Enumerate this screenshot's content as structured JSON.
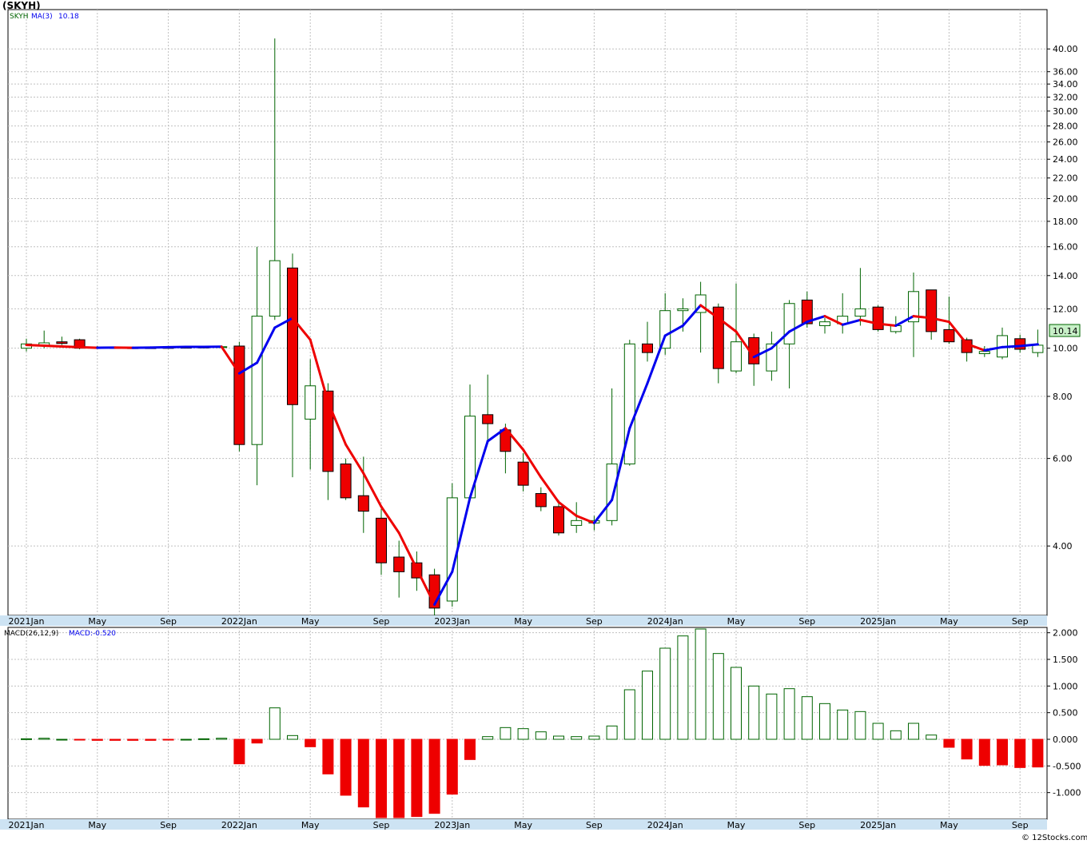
{
  "header": {
    "title": "(SKYH)",
    "legend_symbol": "SKYH",
    "legend_ma": "MA(3)",
    "legend_ma_value": "10.18",
    "last_price": "10.14"
  },
  "macd_header": {
    "label": "MACD(26,12,9)",
    "value_label": "MACD:-0.520"
  },
  "credit": "© 12Stocks.com",
  "colors": {
    "up": "#006400",
    "down": "#ee0000",
    "ma_rising": "#0000ee",
    "ma_falling": "#ee0000",
    "grid": "#c0c0c0",
    "axis_band": "#cde3f3",
    "last_price_bg": "#c8f0c8"
  },
  "chart_data": [
    {
      "type": "candlestick",
      "title": "(SKYH)",
      "scale": "log",
      "ylim": [
        2.9,
        48
      ],
      "grid": true,
      "x_tick_labels": [
        "2021Jan",
        "May",
        "Sep",
        "2022Jan",
        "May",
        "Sep",
        "2023Jan",
        "May",
        "Sep",
        "2024Jan",
        "May",
        "Sep",
        "2025Jan",
        "May",
        "Sep"
      ],
      "y_tick_labels": [
        "4.00",
        "6.00",
        "8.00",
        "10.00",
        "12.00",
        "14.00",
        "16.00",
        "18.00",
        "20.00",
        "22.00",
        "24.00",
        "26.00",
        "28.00",
        "30.00",
        "32.00",
        "34.00",
        "36.00",
        "40.00"
      ],
      "candles": [
        {
          "m": "2021-01",
          "o": 10.0,
          "h": 10.45,
          "l": 9.85,
          "c": 10.2
        },
        {
          "m": "2021-02",
          "o": 10.1,
          "h": 10.85,
          "l": 10.0,
          "c": 10.25
        },
        {
          "m": "2021-03",
          "o": 10.3,
          "h": 10.55,
          "l": 10.15,
          "c": 10.22
        },
        {
          "m": "2021-04",
          "o": 10.4,
          "h": 10.45,
          "l": 9.95,
          "c": 10.0
        },
        {
          "m": "2021-05",
          "o": 10.05,
          "h": 10.1,
          "l": 9.97,
          "c": 10.02
        },
        {
          "m": "2021-06",
          "o": 10.03,
          "h": 10.06,
          "l": 9.98,
          "c": 10.01
        },
        {
          "m": "2021-07",
          "o": 10.02,
          "h": 10.05,
          "l": 9.98,
          "c": 10.0
        },
        {
          "m": "2021-08",
          "o": 10.02,
          "h": 10.06,
          "l": 9.98,
          "c": 10.01
        },
        {
          "m": "2021-09",
          "o": 10.03,
          "h": 10.08,
          "l": 9.99,
          "c": 10.02
        },
        {
          "m": "2021-10",
          "o": 10.04,
          "h": 10.09,
          "l": 10.0,
          "c": 10.03
        },
        {
          "m": "2021-11",
          "o": 10.05,
          "h": 10.1,
          "l": 10.0,
          "c": 10.04
        },
        {
          "m": "2021-12",
          "o": 10.06,
          "h": 10.12,
          "l": 10.01,
          "c": 10.07
        },
        {
          "m": "2022-01",
          "o": 10.1,
          "h": 10.3,
          "l": 6.2,
          "c": 6.4
        },
        {
          "m": "2022-02",
          "o": 6.4,
          "h": 16.0,
          "l": 5.3,
          "c": 11.6
        },
        {
          "m": "2022-03",
          "o": 11.6,
          "h": 42.0,
          "l": 11.4,
          "c": 15.0
        },
        {
          "m": "2022-04",
          "o": 14.5,
          "h": 15.5,
          "l": 5.5,
          "c": 7.7
        },
        {
          "m": "2022-05",
          "o": 7.2,
          "h": 9.5,
          "l": 5.7,
          "c": 8.4
        },
        {
          "m": "2022-06",
          "o": 8.2,
          "h": 8.5,
          "l": 4.95,
          "c": 5.65
        },
        {
          "m": "2022-07",
          "o": 5.85,
          "h": 6.0,
          "l": 4.95,
          "c": 5.0
        },
        {
          "m": "2022-08",
          "o": 5.05,
          "h": 6.05,
          "l": 4.25,
          "c": 4.7
        },
        {
          "m": "2022-09",
          "o": 4.55,
          "h": 4.75,
          "l": 3.5,
          "c": 3.7
        },
        {
          "m": "2022-10",
          "o": 3.8,
          "h": 4.1,
          "l": 3.15,
          "c": 3.55
        },
        {
          "m": "2022-11",
          "o": 3.7,
          "h": 3.9,
          "l": 3.25,
          "c": 3.45
        },
        {
          "m": "2022-12",
          "o": 3.5,
          "h": 3.6,
          "l": 2.85,
          "c": 3.0
        },
        {
          "m": "2023-01",
          "o": 3.1,
          "h": 5.35,
          "l": 3.02,
          "c": 5.0
        },
        {
          "m": "2023-02",
          "o": 5.0,
          "h": 8.45,
          "l": 5.0,
          "c": 7.3
        },
        {
          "m": "2023-03",
          "o": 7.35,
          "h": 8.85,
          "l": 6.5,
          "c": 7.05
        },
        {
          "m": "2023-04",
          "o": 6.85,
          "h": 7.05,
          "l": 5.6,
          "c": 6.2
        },
        {
          "m": "2023-05",
          "o": 5.9,
          "h": 6.15,
          "l": 5.15,
          "c": 5.3
        },
        {
          "m": "2023-06",
          "o": 5.1,
          "h": 5.25,
          "l": 4.7,
          "c": 4.8
        },
        {
          "m": "2023-07",
          "o": 4.8,
          "h": 4.95,
          "l": 4.2,
          "c": 4.25
        },
        {
          "m": "2023-08",
          "o": 4.4,
          "h": 4.9,
          "l": 4.25,
          "c": 4.5
        },
        {
          "m": "2023-09",
          "o": 4.45,
          "h": 4.6,
          "l": 4.3,
          "c": 4.5
        },
        {
          "m": "2023-10",
          "o": 4.5,
          "h": 8.3,
          "l": 4.4,
          "c": 5.85
        },
        {
          "m": "2023-11",
          "o": 5.85,
          "h": 10.4,
          "l": 5.8,
          "c": 10.2
        },
        {
          "m": "2023-12",
          "o": 10.2,
          "h": 11.3,
          "l": 9.4,
          "c": 9.8
        },
        {
          "m": "2024-01",
          "o": 10.0,
          "h": 12.9,
          "l": 9.7,
          "c": 11.9
        },
        {
          "m": "2024-02",
          "o": 11.9,
          "h": 12.6,
          "l": 10.8,
          "c": 12.0
        },
        {
          "m": "2024-03",
          "o": 11.8,
          "h": 13.6,
          "l": 9.8,
          "c": 12.8
        },
        {
          "m": "2024-04",
          "o": 12.1,
          "h": 12.3,
          "l": 8.5,
          "c": 9.1
        },
        {
          "m": "2024-05",
          "o": 9.0,
          "h": 13.5,
          "l": 8.9,
          "c": 10.3
        },
        {
          "m": "2024-06",
          "o": 10.5,
          "h": 10.7,
          "l": 8.4,
          "c": 9.3
        },
        {
          "m": "2024-07",
          "o": 9.0,
          "h": 10.8,
          "l": 8.6,
          "c": 10.2
        },
        {
          "m": "2024-08",
          "o": 10.2,
          "h": 12.5,
          "l": 8.3,
          "c": 12.3
        },
        {
          "m": "2024-09",
          "o": 12.5,
          "h": 13.0,
          "l": 11.0,
          "c": 11.2
        },
        {
          "m": "2024-10",
          "o": 11.1,
          "h": 11.5,
          "l": 10.7,
          "c": 11.3
        },
        {
          "m": "2024-11",
          "o": 11.2,
          "h": 12.9,
          "l": 10.7,
          "c": 11.6
        },
        {
          "m": "2024-12",
          "o": 11.6,
          "h": 14.5,
          "l": 11.1,
          "c": 12.0
        },
        {
          "m": "2025-01",
          "o": 12.1,
          "h": 12.2,
          "l": 10.8,
          "c": 10.9
        },
        {
          "m": "2025-02",
          "o": 10.8,
          "h": 11.6,
          "l": 10.7,
          "c": 11.1
        },
        {
          "m": "2025-03",
          "o": 11.3,
          "h": 14.2,
          "l": 9.6,
          "c": 13.0
        },
        {
          "m": "2025-04",
          "o": 13.1,
          "h": 13.1,
          "l": 10.4,
          "c": 10.8
        },
        {
          "m": "2025-05",
          "o": 10.9,
          "h": 12.7,
          "l": 10.2,
          "c": 10.3
        },
        {
          "m": "2025-06",
          "o": 10.4,
          "h": 10.5,
          "l": 9.4,
          "c": 9.8
        },
        {
          "m": "2025-07",
          "o": 9.75,
          "h": 10.1,
          "l": 9.6,
          "c": 9.85
        },
        {
          "m": "2025-08",
          "o": 9.6,
          "h": 11.0,
          "l": 9.5,
          "c": 10.6
        },
        {
          "m": "2025-09",
          "o": 10.45,
          "h": 10.65,
          "l": 9.8,
          "c": 9.95
        },
        {
          "m": "2025-10",
          "o": 9.8,
          "h": 10.9,
          "l": 9.6,
          "c": 10.14
        }
      ],
      "ma3": [
        10.15,
        10.12,
        10.08,
        10.05,
        10.02,
        10.03,
        10.02,
        10.03,
        10.05,
        10.06,
        10.06,
        10.07,
        8.9,
        9.35,
        11.0,
        11.5,
        10.4,
        7.8,
        6.4,
        5.6,
        4.8,
        4.25,
        3.6,
        3.05,
        3.55,
        5.0,
        6.5,
        6.9,
        6.25,
        5.5,
        4.9,
        4.6,
        4.45,
        4.95,
        6.9,
        8.5,
        10.6,
        11.1,
        12.2,
        11.5,
        10.8,
        9.6,
        10.0,
        10.8,
        11.3,
        11.6,
        11.15,
        11.4,
        11.2,
        11.1,
        11.6,
        11.5,
        11.3,
        10.2,
        9.9,
        10.05,
        10.1,
        10.18
      ]
    },
    {
      "type": "bar",
      "title": "MACD(26,12,9)",
      "ylim": [
        -1.5,
        2.1
      ],
      "grid": true,
      "x_tick_labels": [
        "2021Jan",
        "May",
        "Sep",
        "2022Jan",
        "May",
        "Sep",
        "2023Jan",
        "May",
        "Sep",
        "2024Jan",
        "May",
        "Sep",
        "2025Jan",
        "May",
        "Sep"
      ],
      "y_tick_labels": [
        "2.000",
        "1.500",
        "1.000",
        "0.500",
        "0.000",
        "-0.500",
        "-1.000"
      ],
      "values": [
        0.01,
        0.02,
        0.0,
        -0.01,
        -0.02,
        -0.02,
        -0.02,
        -0.02,
        -0.01,
        0.0,
        0.01,
        0.02,
        -0.46,
        -0.07,
        0.59,
        0.07,
        -0.14,
        -0.65,
        -1.05,
        -1.27,
        -1.47,
        -1.47,
        -1.45,
        -1.39,
        -1.03,
        -0.38,
        0.05,
        0.22,
        0.2,
        0.14,
        0.06,
        0.05,
        0.06,
        0.25,
        0.93,
        1.28,
        1.71,
        1.94,
        2.07,
        1.61,
        1.35,
        1.0,
        0.85,
        0.95,
        0.8,
        0.67,
        0.55,
        0.52,
        0.3,
        0.16,
        0.3,
        0.08,
        -0.15,
        -0.37,
        -0.49,
        -0.48,
        -0.53,
        -0.52
      ]
    }
  ]
}
